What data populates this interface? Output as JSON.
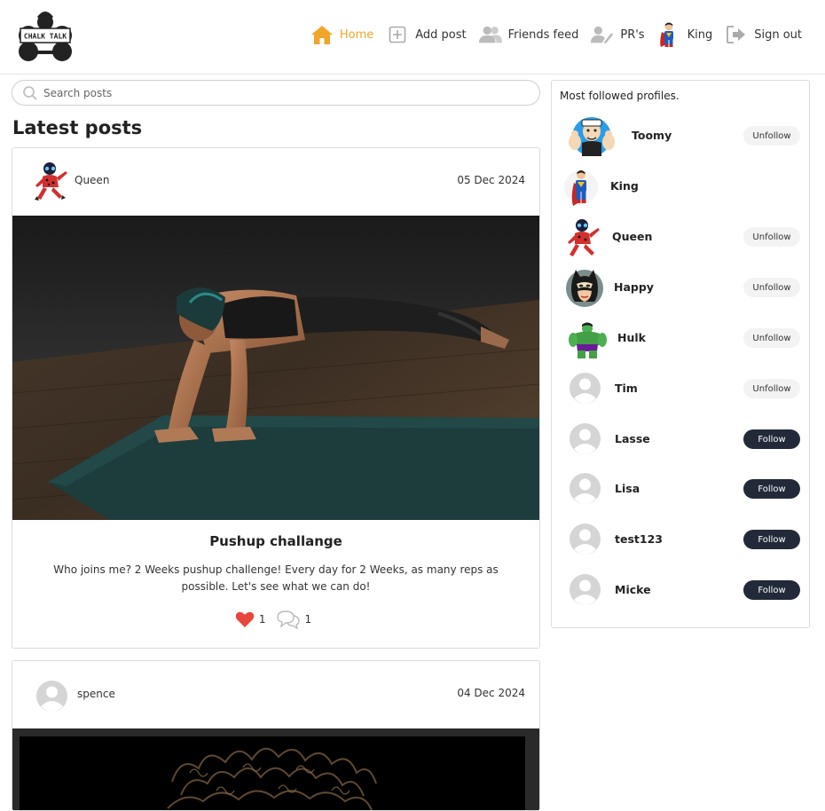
{
  "brand": {
    "logo_text": "CHALK TALK"
  },
  "nav": {
    "items": [
      {
        "label": "Home",
        "icon": "home-icon",
        "active": true
      },
      {
        "label": "Add post",
        "icon": "add-post-icon"
      },
      {
        "label": "Friends feed",
        "icon": "friends-icon"
      },
      {
        "label": "PR's",
        "icon": "pr-icon"
      },
      {
        "label": "King",
        "icon": "superman-avatar"
      },
      {
        "label": "Sign out",
        "icon": "sign-out-icon"
      }
    ]
  },
  "search": {
    "placeholder": "Search posts",
    "value": ""
  },
  "feed": {
    "title": "Latest posts",
    "posts": [
      {
        "author": "Queen",
        "date": "05 Dec 2024",
        "image": "woman-doing-pushups-on-mat",
        "title": "Pushup challange",
        "body": "Who joins me? 2 Weeks pushup challenge! Every day for 2 Weeks, as many reps as possible. Let's see what we can do!",
        "likes": "1",
        "comments": "1"
      },
      {
        "author": "spence",
        "date": "04 Dec 2024",
        "image": "curly-hair-photo"
      }
    ]
  },
  "sidebar": {
    "title": "Most followed profiles.",
    "profiles": [
      {
        "name": "Toomy",
        "button": "Unfollow",
        "avatar": "popeye-avatar"
      },
      {
        "name": "King",
        "button": "",
        "avatar": "superman-avatar"
      },
      {
        "name": "Queen",
        "button": "Unfollow",
        "avatar": "ladybug-avatar"
      },
      {
        "name": "Happy",
        "button": "Unfollow",
        "avatar": "catwoman-avatar"
      },
      {
        "name": "Hulk",
        "button": "Unfollow",
        "avatar": "hulk-avatar"
      },
      {
        "name": "Tim",
        "button": "Unfollow",
        "avatar": "default-avatar"
      },
      {
        "name": "Lasse",
        "button": "Follow",
        "avatar": "default-avatar"
      },
      {
        "name": "Lisa",
        "button": "Follow",
        "avatar": "default-avatar"
      },
      {
        "name": "test123",
        "button": "Follow",
        "avatar": "default-avatar"
      },
      {
        "name": "Micke",
        "button": "Follow",
        "avatar": "default-avatar"
      }
    ]
  },
  "colors": {
    "accent": "#f0a52b",
    "follow_button": "#222a3a",
    "unfollow_button": "#f3f3f3",
    "like_heart": "#e8453c"
  }
}
